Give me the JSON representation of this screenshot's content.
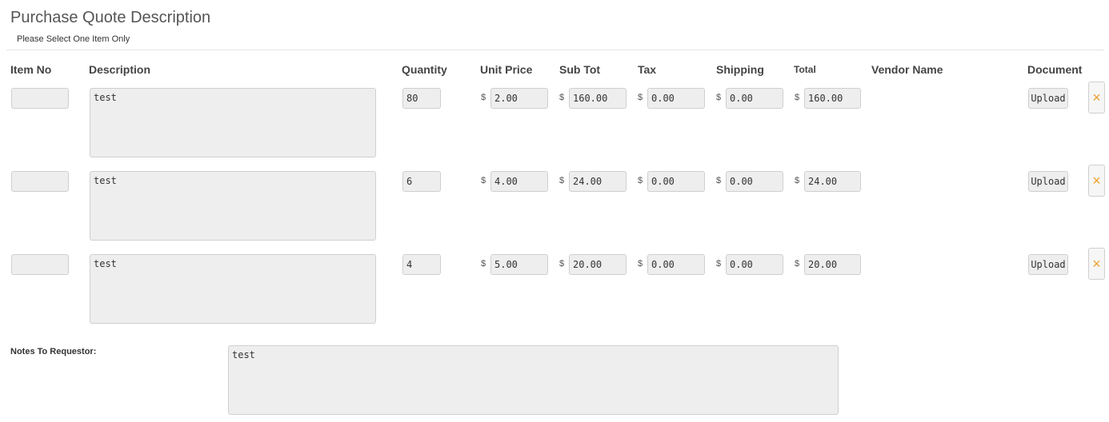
{
  "header": {
    "title": "Purchase Quote Description",
    "subtitle": "Please Select One Item Only"
  },
  "columns": {
    "item_no": "Item No",
    "description": "Description",
    "quantity": "Quantity",
    "unit_price": "Unit Price",
    "sub_tot": "Sub Tot",
    "tax": "Tax",
    "shipping": "Shipping",
    "total": "Total",
    "vendor_name": "Vendor Name",
    "document": "Document"
  },
  "currency_symbol": "$",
  "upload_label": "Upload",
  "remove_icon": "×",
  "rows": [
    {
      "item_no": "",
      "description": "test",
      "quantity": "80",
      "unit_price": "2.00",
      "sub_tot": "160.00",
      "tax": "0.00",
      "shipping": "0.00",
      "total": "160.00"
    },
    {
      "item_no": "",
      "description": "test",
      "quantity": "6",
      "unit_price": "4.00",
      "sub_tot": "24.00",
      "tax": "0.00",
      "shipping": "0.00",
      "total": "24.00"
    },
    {
      "item_no": "",
      "description": "test",
      "quantity": "4",
      "unit_price": "5.00",
      "sub_tot": "20.00",
      "tax": "0.00",
      "shipping": "0.00",
      "total": "20.00"
    }
  ],
  "notes": {
    "label": "Notes To Requestor:",
    "value": "test"
  },
  "colors": {
    "field_bg": "#eeeeee",
    "field_border": "#cfcfcf",
    "remove_icon": "#f0a030"
  }
}
